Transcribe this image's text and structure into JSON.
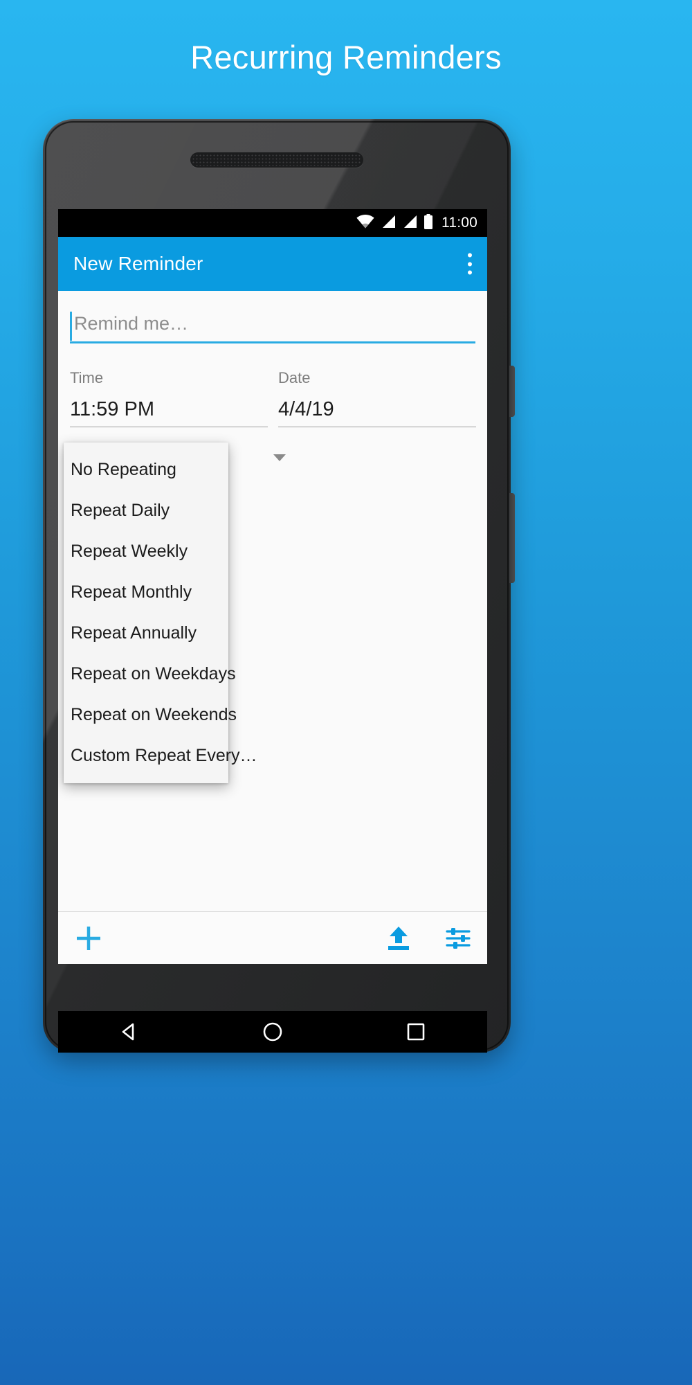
{
  "page": {
    "heading": "Recurring Reminders",
    "background_top": "#29b6f0",
    "background_bottom": "#1867b8"
  },
  "status_bar": {
    "time": "11:00",
    "icons": [
      "wifi-icon",
      "signal-icon",
      "signal-icon",
      "battery-icon"
    ]
  },
  "app_bar": {
    "title": "New Reminder",
    "color": "#0a9be0",
    "overflow_label": "more-options"
  },
  "form": {
    "title_field": {
      "value": "",
      "placeholder": "Remind me…"
    },
    "time": {
      "label": "Time",
      "value": "11:59 PM"
    },
    "date": {
      "label": "Date",
      "value": "4/4/19"
    }
  },
  "repeat_dropdown": {
    "open": true,
    "items": [
      {
        "label": "No Repeating"
      },
      {
        "label": "Repeat Daily"
      },
      {
        "label": "Repeat Weekly"
      },
      {
        "label": "Repeat Monthly"
      },
      {
        "label": "Repeat Annually"
      },
      {
        "label": "Repeat on Weekdays"
      },
      {
        "label": "Repeat on Weekends"
      },
      {
        "label": "Custom Repeat Every…"
      }
    ]
  },
  "bottom_bar": {
    "accent": "#29abe2",
    "actions": [
      {
        "name": "add-reminder-button",
        "icon": "plus-icon"
      },
      {
        "name": "export-button",
        "icon": "upload-icon"
      },
      {
        "name": "settings-button",
        "icon": "tune-sliders-icon"
      }
    ]
  },
  "nav_bar": {
    "items": [
      {
        "name": "nav-back",
        "icon": "back-triangle-icon"
      },
      {
        "name": "nav-home",
        "icon": "home-circle-icon"
      },
      {
        "name": "nav-recents",
        "icon": "recents-square-icon"
      }
    ]
  }
}
